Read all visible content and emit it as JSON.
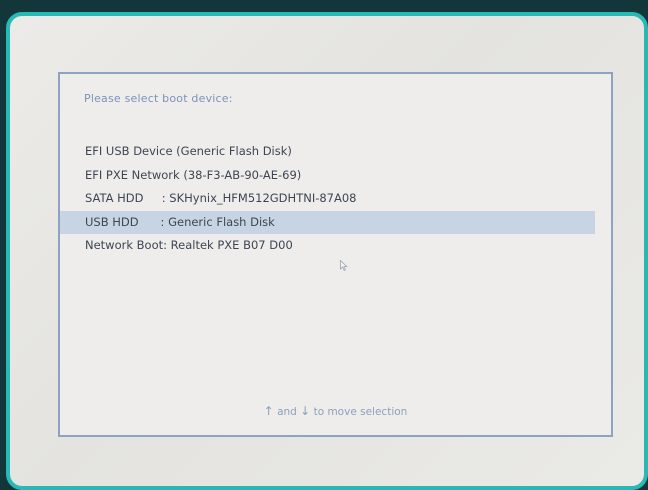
{
  "boot_menu": {
    "prompt": "Please select boot device:",
    "devices": [
      {
        "label": "EFI USB Device (Generic Flash Disk)",
        "selected": false
      },
      {
        "label": "EFI PXE Network (38-F3-AB-90-AE-69)",
        "selected": false
      },
      {
        "label": "SATA HDD     : SKHynix_HFM512GDHTNI-87A08",
        "selected": false
      },
      {
        "label": "USB HDD      : Generic Flash Disk",
        "selected": true
      },
      {
        "label": "Network Boot: Realtek PXE B07 D00",
        "selected": false
      }
    ],
    "hint": {
      "up_arrow": "↑",
      "and": "and",
      "down_arrow": "↓",
      "text": "to move selection"
    }
  },
  "colors": {
    "bezel": "#27b9b5",
    "background": "#12363a",
    "selection": "#c7d4e3",
    "prompt_text": "#7b93b8"
  }
}
